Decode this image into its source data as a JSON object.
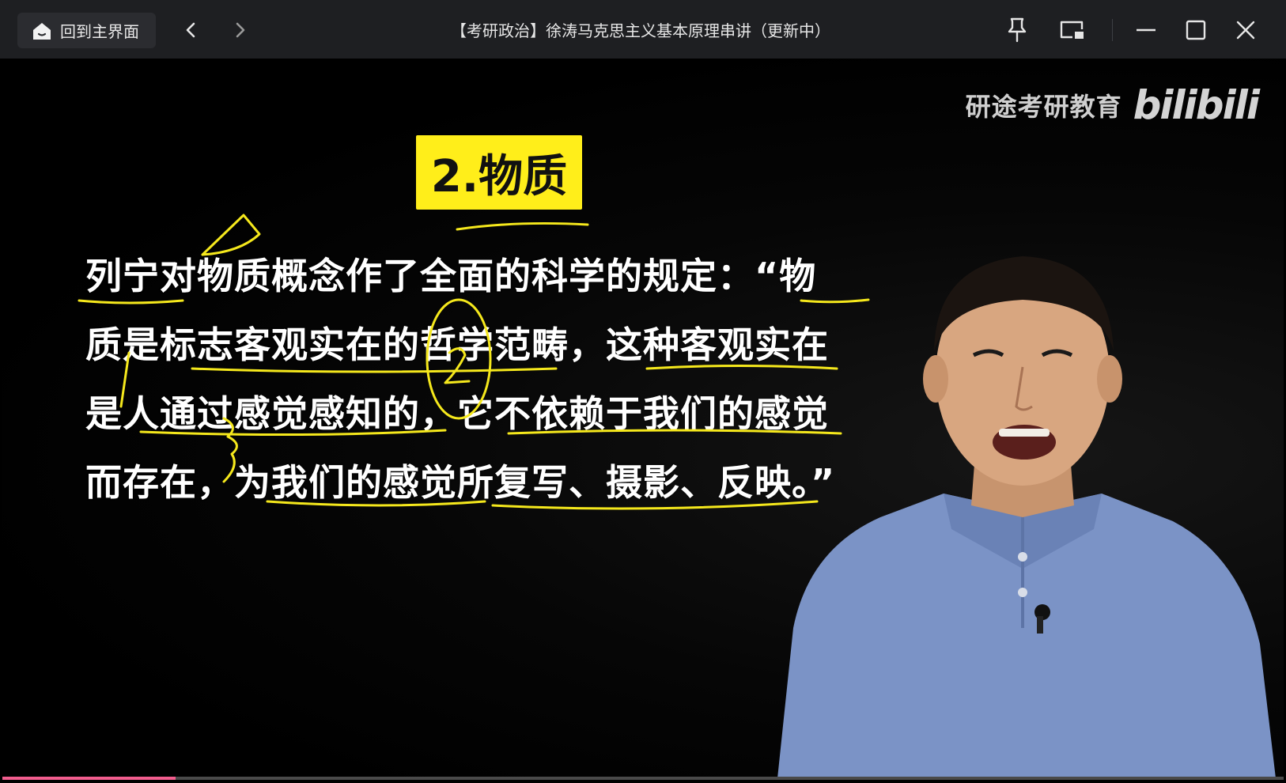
{
  "titlebar": {
    "home_label": "回到主界面",
    "title": "【考研政治】徐涛马克思主义基本原理串讲（更新中）",
    "icons": [
      "home-icon",
      "chevron-left-icon",
      "chevron-right-icon",
      "pin-icon",
      "picture-in-picture-icon",
      "minimize-icon",
      "maximize-icon",
      "close-icon"
    ]
  },
  "video": {
    "watermark_org": "研途考研教育",
    "watermark_logo": "bilibili",
    "section_title": "2.物质",
    "lines": [
      "列宁对物质概念作了全面的科学的规定：“物",
      "质是标志客观实在的哲学范畴，这种客观实在",
      "是人通过感觉感知的，它不依赖于我们的感觉",
      "而存在，为我们的感觉所复写、摄影、反映。”"
    ],
    "annotation_color": "#f5e81c",
    "title_bg": "#ffee1a",
    "progress": 0.135,
    "progress_color": "#f25d8e"
  }
}
